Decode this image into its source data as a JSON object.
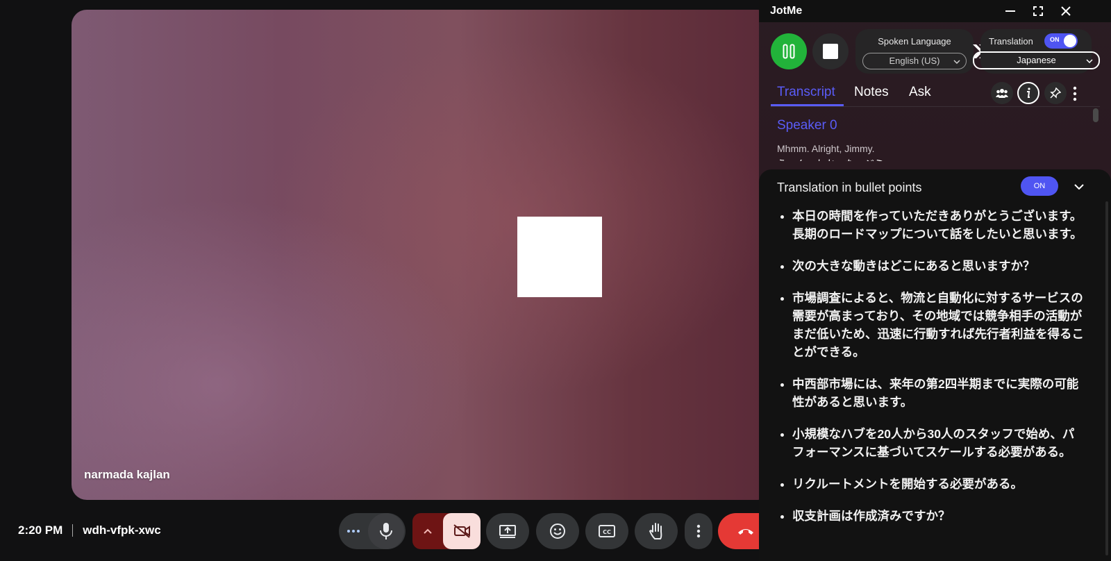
{
  "meet": {
    "participant_name": "narmada kajlan",
    "time": "2:20 PM",
    "meeting_code": "wdh-vfpk-xwc",
    "controls": [
      "more-options",
      "microphone",
      "camera-off",
      "present",
      "emoji",
      "captions",
      "raise-hand",
      "more",
      "end-call"
    ]
  },
  "jotme": {
    "app_title": "JotMe",
    "spoken_language": {
      "label": "Spoken Language",
      "value": "English (US)"
    },
    "translation": {
      "label": "Translation",
      "toggle": "ON",
      "value": "Japanese"
    },
    "tabs": [
      "Transcript",
      "Notes",
      "Ask"
    ],
    "active_tab": "Transcript",
    "transcript": {
      "speaker": "Speaker 0",
      "text": "Mhmm. Alright, Jimmy.",
      "translation_partial": "うーん、わかった、ジミー。"
    },
    "bullet_card": {
      "title": "Translation in bullet points",
      "toggle": "ON",
      "bullets": [
        "本日の時間を作っていただきありがとうございます。長期のロードマップについて話をしたいと思います。",
        "次の大きな動きはどこにあると思いますか？",
        "市場調査によると、物流と自動化に対するサービスの需要が高まっており、その地域では競争相手の活動がまだ低いため、迅速に行動すれば先行者利益を得ることができる。",
        "中西部市場には、来年の第2四半期までに実際の可能性があると思います。",
        "小規模なハブを20人から30人のスタッフで始め、パフォーマンスに基づいてスケールする必要がある。",
        "リクルートメントを開始する必要がある。",
        "収支計画は作成済みですか？"
      ]
    },
    "colors": {
      "accent": "#5a5cf7",
      "record_green": "#22b33a",
      "end_call_red": "#e53935"
    }
  }
}
